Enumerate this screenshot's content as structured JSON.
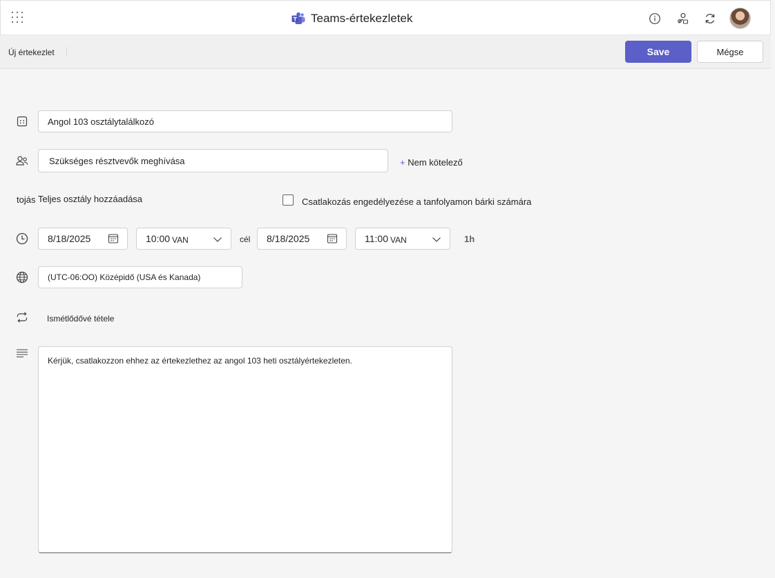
{
  "header": {
    "app_title": "Teams-értekezletek",
    "icons": [
      "waffle-icon",
      "info-icon",
      "people-settings-icon",
      "refresh-icon",
      "avatar"
    ]
  },
  "command_bar": {
    "breadcrumb": "Új értekezlet",
    "save_label": "Save",
    "cancel_label": "Mégse"
  },
  "form": {
    "title_value": "Angol 103 osztálytalálkozó",
    "attendees_value": "Szükséges résztvevők meghívása",
    "optional_label": "Nem kötelező",
    "optional_plus": "+",
    "class_prefix": "tojás",
    "class_link": "Teljes osztály hozzáadása",
    "allow_join_label": "Csatlakozás engedélyezése a tanfolyamon bárki számára",
    "start_date": "8/18/2025",
    "start_time": "10:00",
    "start_ampm": "VAN",
    "to_label": "cél",
    "end_date": "8/18/2025",
    "end_time": "11:00",
    "end_ampm": "VAN",
    "duration": "1h",
    "timezone": "(UTC-06:OO) Középidő (USA és Kanada)",
    "recurrence_label": "Ismétlődővé tétele",
    "description": "Kérjük, csatlakozzon ehhez az értekezlethez az angol 103 heti osztályértekezleten."
  },
  "colors": {
    "accent": "#5b5fc7",
    "teams_logo": "#5b5fc7"
  }
}
